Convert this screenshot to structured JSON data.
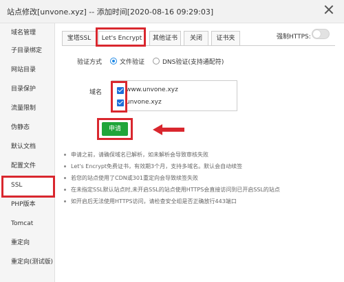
{
  "window": {
    "title": "站点修改[unvone.xyz] -- 添加时间[2020-08-16 09:29:03]"
  },
  "sidebar": {
    "items": [
      {
        "label": "域名管理"
      },
      {
        "label": "子目录绑定"
      },
      {
        "label": "网站目录"
      },
      {
        "label": "目录保护"
      },
      {
        "label": "流量限制"
      },
      {
        "label": "伪静态"
      },
      {
        "label": "默认文档"
      },
      {
        "label": "配置文件"
      },
      {
        "label": "SSL"
      },
      {
        "label": "PHP版本"
      },
      {
        "label": "Tomcat"
      },
      {
        "label": "重定向"
      },
      {
        "label": "重定向(测试版)"
      }
    ],
    "active_index": 8
  },
  "tabs": [
    {
      "label": "宝塔SSL"
    },
    {
      "label": "Let's Encrypt"
    },
    {
      "label": "其他证书"
    },
    {
      "label": "关闭"
    },
    {
      "label": "证书夹"
    }
  ],
  "active_tab_index": 1,
  "force_https": {
    "label": "强制HTTPS:",
    "enabled": false
  },
  "verify": {
    "label": "验证方式",
    "options": [
      {
        "label": "文件验证",
        "checked": true
      },
      {
        "label": "DNS验证(支持通配符)",
        "checked": false
      }
    ]
  },
  "domains": {
    "label": "域名",
    "items": [
      {
        "name": "www.unvone.xyz",
        "checked": true
      },
      {
        "name": "unvone.xyz",
        "checked": true
      }
    ]
  },
  "apply_button": {
    "label": "申请"
  },
  "notes": [
    "申请之前，请确保域名已解析，如未解析会导致审核失败",
    "Let's Encrypt免费证书，有效期3个月，支持多域名。默认会自动续签",
    "若您的站点使用了CDN或301重定向会导致续签失败",
    "在未指定SSL默认站点时,未开启SSL的站点使用HTTPS会直接访问到已开启SSL的站点",
    "如开启后无法使用HTTPS访问，请检查安全组是否正确放行443端口"
  ],
  "colors": {
    "annotation": "#d9272e",
    "apply_button": "#20a53a",
    "checkbox": "#1e6fd9"
  }
}
